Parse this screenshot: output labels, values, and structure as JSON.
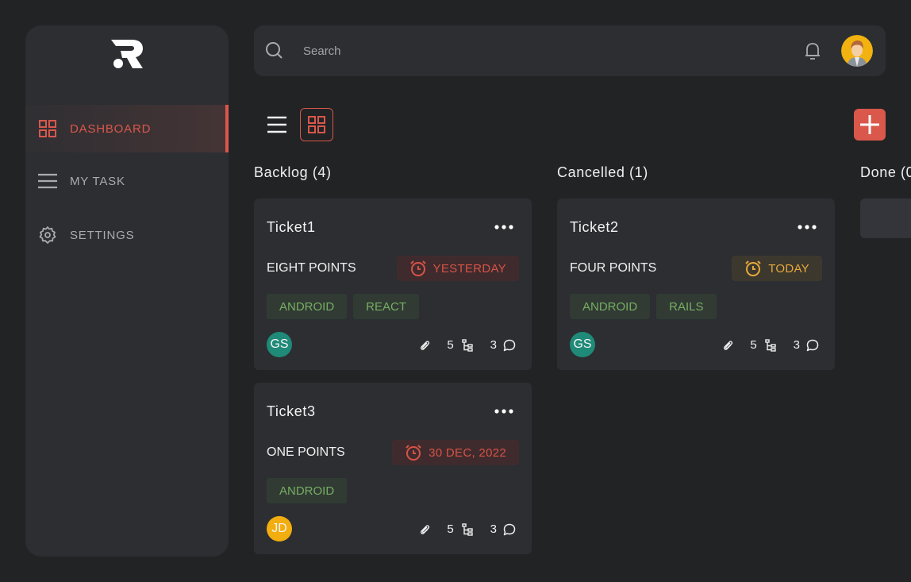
{
  "sidebar": {
    "items": [
      {
        "label": "DASHBOARD",
        "icon": "grid-icon",
        "active": true
      },
      {
        "label": "MY TASK",
        "icon": "list-icon",
        "active": false
      },
      {
        "label": "SETTINGS",
        "icon": "gear-icon",
        "active": false
      }
    ]
  },
  "header": {
    "search_placeholder": "Search"
  },
  "colors": {
    "accent": "#d9574b",
    "tag_text": "#76ad62",
    "due_amber": "#e6a93b",
    "avatar_teal": "#1f8a78",
    "avatar_yellow": "#f2ad0f"
  },
  "columns": [
    {
      "title": "Backlog (4)",
      "cards": [
        {
          "title": "Ticket1",
          "points": "EIGHT POINTS",
          "due": "YESTERDAY",
          "due_style": "red",
          "tags": [
            "ANDROID",
            "REACT"
          ],
          "assignee": "GS",
          "subtasks": "5",
          "comments": "3"
        },
        {
          "title": "Ticket3",
          "points": "ONE POINTS",
          "due": "30 DEC, 2022",
          "due_style": "red",
          "tags": [
            "ANDROID"
          ],
          "assignee": "JD",
          "subtasks": "5",
          "comments": "3"
        }
      ]
    },
    {
      "title": "Cancelled (1)",
      "cards": [
        {
          "title": "Ticket2",
          "points": "FOUR POINTS",
          "due": "TODAY",
          "due_style": "amber",
          "tags": [
            "ANDROID",
            "RAILS"
          ],
          "assignee": "GS",
          "subtasks": "5",
          "comments": "3"
        }
      ]
    },
    {
      "title": "Done (0",
      "cards": []
    }
  ]
}
